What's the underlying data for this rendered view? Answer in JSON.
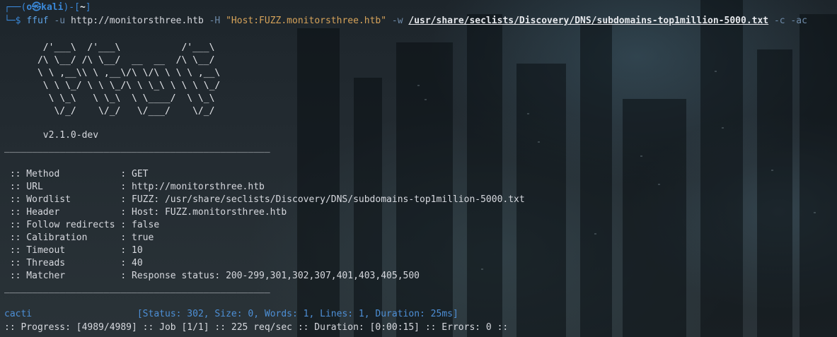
{
  "prompt": {
    "top": "┌──(",
    "user": "o㉿kali",
    "mid": ")-[",
    "dir": "~",
    "end": "]",
    "bottom": "└─$ "
  },
  "command": {
    "name": "ffuf",
    "flag_u": " -u ",
    "url": "http://monitorsthree.htb",
    "flag_h": " -H ",
    "header": "\"Host:FUZZ.monitorsthree.htb\"",
    "flag_w": " -w ",
    "wordlist": "/usr/share/seclists/Discovery/DNS/subdomains-top1million-5000.txt",
    "flag_c": " -c",
    "flag_ac": " -ac"
  },
  "banner": [
    "       /'___\\  /'___\\           /'___\\",
    "      /\\ \\__/ /\\ \\__/  __  __  /\\ \\__/",
    "      \\ \\ ,__\\\\ \\ ,__\\/\\ \\/\\ \\ \\ \\ ,__\\",
    "       \\ \\ \\_/ \\ \\ \\_/\\ \\ \\_\\ \\ \\ \\ \\_/",
    "        \\ \\_\\   \\ \\_\\  \\ \\____/  \\ \\_\\",
    "         \\/_/    \\/_/   \\/___/    \\/_/"
  ],
  "version": "       v2.1.0-dev",
  "rule": "________________________________________________",
  "config": [
    {
      "key": " :: Method           : ",
      "value": "GET"
    },
    {
      "key": " :: URL              : ",
      "value": "http://monitorsthree.htb"
    },
    {
      "key": " :: Wordlist         : ",
      "value": "FUZZ: /usr/share/seclists/Discovery/DNS/subdomains-top1million-5000.txt"
    },
    {
      "key": " :: Header           : ",
      "value": "Host: FUZZ.monitorsthree.htb"
    },
    {
      "key": " :: Follow redirects : ",
      "value": "false"
    },
    {
      "key": " :: Calibration      : ",
      "value": "true"
    },
    {
      "key": " :: Timeout          : ",
      "value": "10"
    },
    {
      "key": " :: Threads          : ",
      "value": "40"
    },
    {
      "key": " :: Matcher          : ",
      "value": "Response status: 200-299,301,302,307,401,403,405,500"
    }
  ],
  "result": {
    "word": "cacti",
    "pad": "                   ",
    "info": "[Status: 302, Size: 0, Words: 1, Lines: 1, Duration: 25ms]"
  },
  "progress": ":: Progress: [4989/4989] :: Job [1/1] :: 225 req/sec :: Duration: [0:00:15] :: Errors: 0 ::",
  "colors": {
    "prompt_blue": "#3a88d8",
    "result_blue": "#4d8fd6",
    "string_amber": "#d6a35a",
    "text": "#d6d8de"
  }
}
